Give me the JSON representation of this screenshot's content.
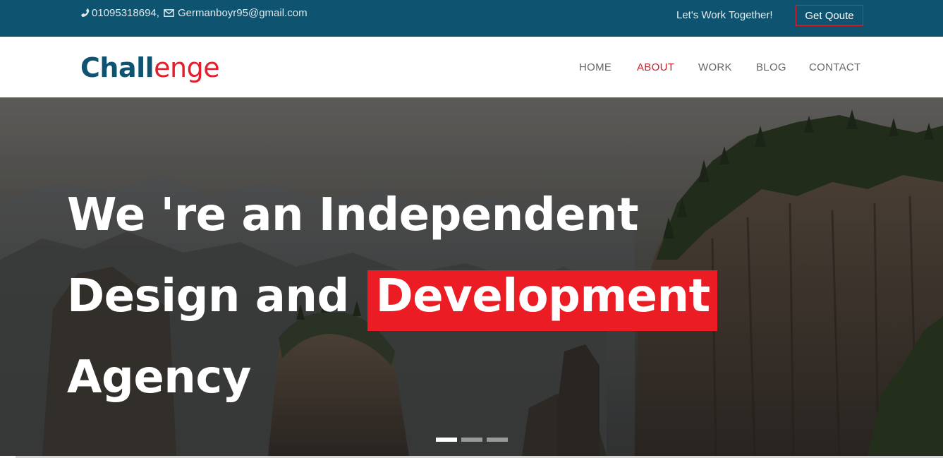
{
  "topbar": {
    "phone": "01095318694,",
    "email": "Germanboyr95@gmail.com",
    "tagline": "Let's Work Together!",
    "quote_button": "Get Qoute"
  },
  "header": {
    "logo_part_a": "Chall",
    "logo_part_b": "enge",
    "nav": [
      {
        "label": "HOME",
        "active": false
      },
      {
        "label": "ABOUT",
        "active": true
      },
      {
        "label": "WORK",
        "active": false
      },
      {
        "label": "BLOG",
        "active": false
      },
      {
        "label": "CONTACT",
        "active": false
      }
    ]
  },
  "hero": {
    "line1": "We 're an Independent",
    "line2_prefix": "Design and",
    "line2_highlight": "Development",
    "line3": "Agency",
    "slides_total": 3,
    "active_slide": 1
  },
  "colors": {
    "topbar_bg": "#0e5470",
    "brand_red": "#ec1c24",
    "nav_text": "#666666",
    "nav_active": "#c8202b"
  },
  "icons": [
    "phone-icon",
    "envelope-icon"
  ]
}
